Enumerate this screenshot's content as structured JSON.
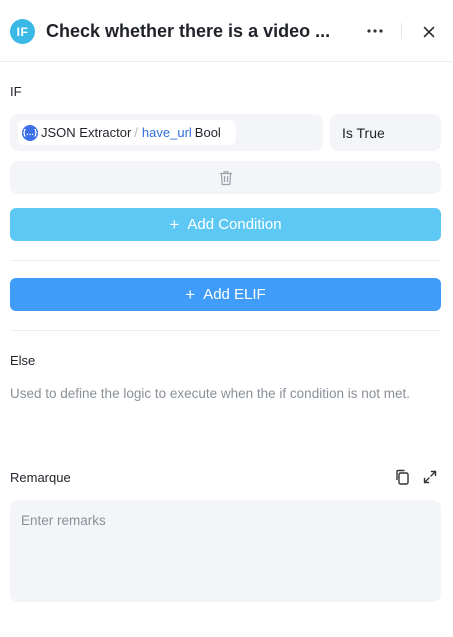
{
  "header": {
    "node_badge": "IF",
    "title": "Check whether there is a video ...",
    "accent_color": "#3ab8e6"
  },
  "if_section": {
    "label": "IF",
    "condition": {
      "source_node": "JSON Extractor",
      "separator": "/",
      "variable": "have_url",
      "variable_type": "Bool",
      "operator": "Is True"
    },
    "add_condition_label": "Add Condition",
    "add_condition_color": "#5ec8f5"
  },
  "elif": {
    "add_elif_label": "Add ELIF",
    "add_elif_color": "#3f9cf8"
  },
  "else_section": {
    "label": "Else",
    "description": "Used to define the logic to execute when the if condition is not met."
  },
  "remarks": {
    "label": "Remarque",
    "placeholder": "Enter remarks",
    "value": ""
  },
  "icons": {
    "more": "more-icon",
    "close": "close-icon",
    "delete": "trash-icon",
    "copy": "copy-icon",
    "expand": "expand-icon",
    "variable": "braces-icon"
  }
}
